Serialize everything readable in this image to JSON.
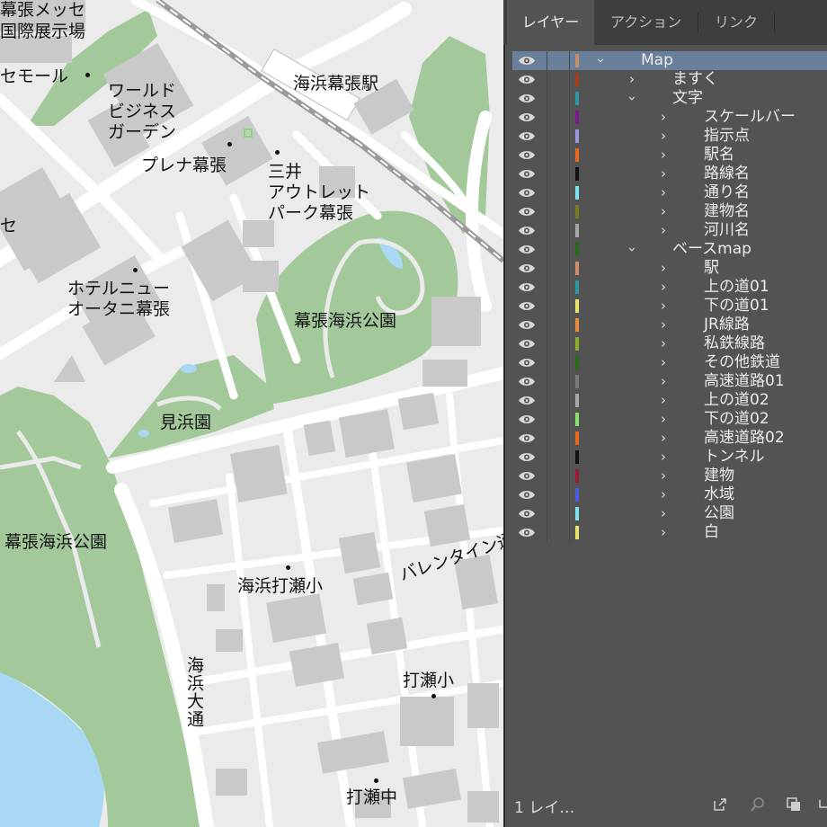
{
  "map": {
    "labels": {
      "makuhari_messe": "幕張メッセ",
      "kokusai_tenjijo": "国際展示場",
      "semall": "セモール",
      "world_business_garden": "ワールド\nビジネス\nガーデン",
      "station": "海浜幕張駅",
      "plena": "プレナ幕張",
      "mitsui_outlet": "三井\nアウトレット\nパーク幕張",
      "se": "セ",
      "hotel_new_otani": "ホテルニュー\nオータニ幕張",
      "kaihin_park_north": "幕張海浜公園",
      "mihamaen": "見浜園",
      "kaihin_park_west": "幕張海浜公園",
      "kaihin_utase_elem": "海浜打瀬小",
      "valentine": "バレンタイン通",
      "kaihin_odori": "海浜大通",
      "utase_elem": "打瀬小",
      "utase_jh": "打瀬中"
    }
  },
  "panel": {
    "tabs": [
      {
        "label": "レイヤー",
        "active": true
      },
      {
        "label": "アクション",
        "active": false
      },
      {
        "label": "リンク",
        "active": false
      }
    ],
    "layers": [
      {
        "name": "Map",
        "color": "#c8906a",
        "depth": 0,
        "expanded": true,
        "selected": true
      },
      {
        "name": "ますく",
        "color": "#a33e1d",
        "depth": 1,
        "expanded": false
      },
      {
        "name": "文字",
        "color": "#2a9aa0",
        "depth": 1,
        "expanded": true
      },
      {
        "name": "スケールバー",
        "color": "#7a1a8e",
        "depth": 2,
        "expanded": false
      },
      {
        "name": "指示点",
        "color": "#9c95e0",
        "depth": 2,
        "expanded": false
      },
      {
        "name": "駅名",
        "color": "#e5691e",
        "depth": 2,
        "expanded": false
      },
      {
        "name": "路線名",
        "color": "#111111",
        "depth": 2,
        "expanded": false
      },
      {
        "name": "通り名",
        "color": "#7ee5f0",
        "depth": 2,
        "expanded": false
      },
      {
        "name": "建物名",
        "color": "#7a7a22",
        "depth": 2,
        "expanded": false
      },
      {
        "name": "河川名",
        "color": "#a7a7a7",
        "depth": 2,
        "expanded": false
      },
      {
        "name": "ベースmap",
        "color": "#2c6a1a",
        "depth": 1,
        "expanded": true
      },
      {
        "name": "駅",
        "color": "#c8906a",
        "depth": 2,
        "expanded": false
      },
      {
        "name": "上の道01",
        "color": "#2a9aa0",
        "depth": 2,
        "expanded": false
      },
      {
        "name": "下の道01",
        "color": "#e9e56a",
        "depth": 2,
        "expanded": false
      },
      {
        "name": "JR線路",
        "color": "#e88a3c",
        "depth": 2,
        "expanded": false
      },
      {
        "name": "私鉄線路",
        "color": "#8aac2c",
        "depth": 2,
        "expanded": false
      },
      {
        "name": "その他鉄道",
        "color": "#2c6a1a",
        "depth": 2,
        "expanded": false
      },
      {
        "name": "高速道路01",
        "color": "#7a7a7a",
        "depth": 2,
        "expanded": false
      },
      {
        "name": "上の道02",
        "color": "#a7a7a7",
        "depth": 2,
        "expanded": false
      },
      {
        "name": "下の道02",
        "color": "#8ae06a",
        "depth": 2,
        "expanded": false
      },
      {
        "name": "高速道路02",
        "color": "#e5691e",
        "depth": 2,
        "expanded": false
      },
      {
        "name": "トンネル",
        "color": "#111111",
        "depth": 2,
        "expanded": false
      },
      {
        "name": "建物",
        "color": "#9a1a3a",
        "depth": 2,
        "expanded": false
      },
      {
        "name": "水域",
        "color": "#4a5ae0",
        "depth": 2,
        "expanded": false
      },
      {
        "name": "公園",
        "color": "#7ee5f0",
        "depth": 2,
        "expanded": false
      },
      {
        "name": "白",
        "color": "#e9e56a",
        "depth": 2,
        "expanded": false
      }
    ],
    "footer": {
      "count_label": "1 レイ…",
      "icons": [
        "export-icon",
        "search-icon",
        "new-layer-icon",
        "more-icon"
      ]
    },
    "colors": {
      "bg": "#535353",
      "tab_bar": "#3e3e3e",
      "selected_row": "#6a7f99"
    }
  }
}
